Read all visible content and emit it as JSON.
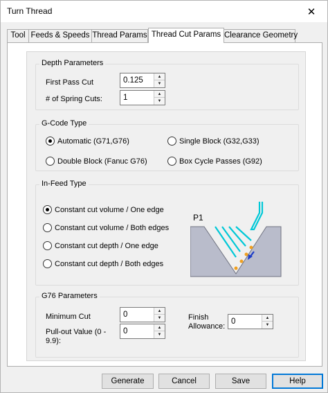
{
  "window": {
    "title": "Turn Thread",
    "close_glyph": "✕"
  },
  "tabs": [
    "Tool",
    "Feeds & Speeds",
    "Thread Params",
    "Thread Cut Params",
    "Clearance Geometry"
  ],
  "active_tab": "Thread Cut Params",
  "depth": {
    "title": "Depth Parameters",
    "first_pass_label": "First Pass Cut",
    "first_pass_value": "0.125",
    "spring_label": "# of Spring Cuts:",
    "spring_value": "1"
  },
  "gcode": {
    "title": "G-Code Type",
    "options": [
      {
        "label": "Automatic (G71,G76)",
        "selected": true
      },
      {
        "label": "Single Block  (G32,G33)",
        "selected": false
      },
      {
        "label": "Double Block (Fanuc G76)",
        "selected": false
      },
      {
        "label": "Box Cycle Passes (G92)",
        "selected": false
      }
    ]
  },
  "infeed": {
    "title": "In-Feed Type",
    "options": [
      {
        "label": "Constant cut volume / One edge",
        "selected": true
      },
      {
        "label": "Constant cut volume / Both edges",
        "selected": false
      },
      {
        "label": "Constant cut depth / One edge",
        "selected": false
      },
      {
        "label": "Constant cut depth / Both edges",
        "selected": false
      }
    ],
    "diagram_label": "P1"
  },
  "g76": {
    "title": "G76 Parameters",
    "min_cut_label": "Minimum Cut",
    "min_cut_value": "0",
    "pullout_label_1": "Pull-out Value (0 -",
    "pullout_label_2": "9.9):",
    "pullout_value": "0",
    "finish_label_1": "Finish",
    "finish_label_2": "Allowance:",
    "finish_value": "0"
  },
  "buttons": {
    "generate": "Generate",
    "cancel": "Cancel",
    "save": "Save",
    "help": "Help"
  },
  "colors": {
    "accent": "#0078d7",
    "diagram_fill": "#b9bccb",
    "diagram_tool": "#00c8d7",
    "diagram_arrow": "#1c3cc8",
    "diagram_points": "#f0a020"
  }
}
